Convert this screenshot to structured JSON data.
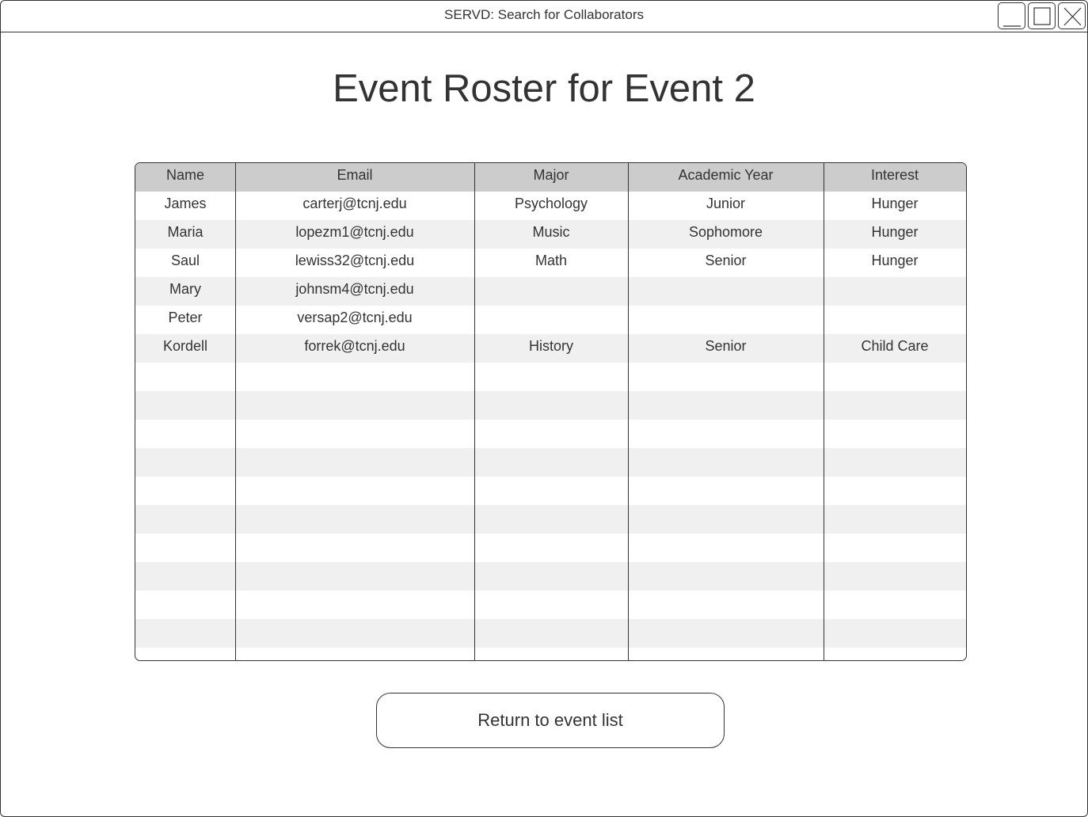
{
  "window": {
    "title": "SERVD: Search for Collaborators",
    "controls": [
      "minimize-icon",
      "maximize-icon",
      "close-icon"
    ]
  },
  "page": {
    "title": "Event Roster for Event 2"
  },
  "table": {
    "headers": [
      "Name",
      "Email",
      "Major",
      "Academic Year",
      "Interest"
    ],
    "rows": [
      [
        "James",
        "carterj@tcnj.edu",
        "Psychology",
        "Junior",
        "Hunger"
      ],
      [
        "Maria",
        "lopezm1@tcnj.edu",
        "Music",
        "Sophomore",
        "Hunger"
      ],
      [
        "Saul",
        "lewiss32@tcnj.edu",
        "Math",
        "Senior",
        "Hunger"
      ],
      [
        "Mary",
        "johnsm4@tcnj.edu",
        "",
        "",
        ""
      ],
      [
        "Peter",
        "versap2@tcnj.edu",
        "",
        "",
        ""
      ],
      [
        "Kordell",
        "forrek@tcnj.edu",
        "History",
        "Senior",
        "Child Care"
      ]
    ],
    "empty_rows": 10
  },
  "actions": {
    "return_label": "Return to event list"
  },
  "colors": {
    "border": "#333333",
    "header_bg": "#cccccc",
    "stripe_bg": "#f0f0f0",
    "text": "#333333"
  }
}
